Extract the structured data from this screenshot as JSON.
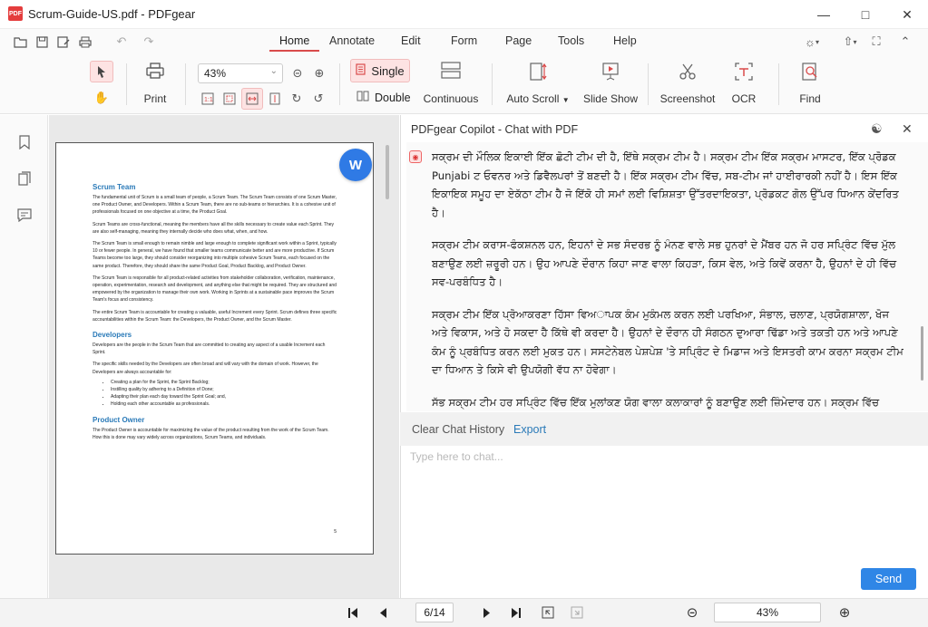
{
  "window": {
    "title": "Scrum-Guide-US.pdf - PDFgear",
    "logo_text": "PDF"
  },
  "menu": {
    "tabs": [
      "Home",
      "Annotate",
      "Edit",
      "Form",
      "Page",
      "Tools",
      "Help"
    ],
    "active_tab": "Home"
  },
  "toolbar": {
    "print_label": "Print",
    "zoom_value": "43%",
    "single_label": "Single",
    "double_label": "Double",
    "continuous_label": "Continuous",
    "auto_scroll_label": "Auto Scroll",
    "slide_show_label": "Slide Show",
    "screenshot_label": "Screenshot",
    "ocr_label": "OCR",
    "find_label": "Find"
  },
  "document": {
    "sections": [
      {
        "heading": "Scrum Team",
        "paragraphs": [
          "The fundamental unit of Scrum is a small team of people, a Scrum Team. The Scrum Team consists of one Scrum Master, one Product Owner, and Developers. Within a Scrum Team, there are no sub-teams or hierarchies. It is a cohesive unit of professionals focused on one objective at a time, the Product Goal.",
          "Scrum Teams are cross-functional, meaning the members have all the skills necessary to create value each Sprint. They are also self-managing, meaning they internally decide who does what, when, and how.",
          "The Scrum Team is small enough to remain nimble and large enough to complete significant work within a Sprint, typically 10 or fewer people. In general, we have found that smaller teams communicate better and are more productive. If Scrum Teams become too large, they should consider reorganizing into multiple cohesive Scrum Teams, each focused on the same product. Therefore, they should share the same Product Goal, Product Backlog, and Product Owner.",
          "The Scrum Team is responsible for all product-related activities from stakeholder collaboration, verification, maintenance, operation, experimentation, research and development, and anything else that might be required. They are structured and empowered by the organization to manage their own work. Working in Sprints at a sustainable pace improves the Scrum Team's focus and consistency.",
          "The entire Scrum Team is accountable for creating a valuable, useful Increment every Sprint. Scrum defines three specific accountabilities within the Scrum Team: the Developers, the Product Owner, and the Scrum Master."
        ]
      },
      {
        "heading": "Developers",
        "paragraphs": [
          "Developers are the people in the Scrum Team that are committed to creating any aspect of a usable Increment each Sprint.",
          "The specific skills needed by the Developers are often broad and will vary with the domain of work. However, the Developers are always accountable for:"
        ],
        "bullets": [
          "Creating a plan for the Sprint, the Sprint Backlog;",
          "Instilling quality by adhering to a Definition of Done;",
          "Adapting their plan each day toward the Sprint Goal; and,",
          "Holding each other accountable as professionals."
        ]
      },
      {
        "heading": "Product Owner",
        "paragraphs": [
          "The Product Owner is accountable for maximizing the value of the product resulting from the work of the Scrum Team. How this is done may vary widely across organizations, Scrum Teams, and individuals."
        ]
      }
    ],
    "page_number": "5"
  },
  "copilot": {
    "title": "PDFgear Copilot - Chat with PDF",
    "messages": [
      "ਸਕ੍ਰਮ ਦੀ ਮੌਲਿਕ ਇਕਾਈ ਇੱਕ ਛੋਟੀ ਟੀਮ ਦੀ ਹੈ, ਇੱਥੇ ਸਕ੍ਰਮ ਟੀਮ ਹੈ। ਸਕ੍ਰਮ ਟੀਮ ਇੱਕ ਸਕ੍ਰਮ ਮਾਸਟਰ, ਇੱਕ ਪ੍ਰੋਡਕ Punjabi ਟ ਓਵਨਰ ਅਤੇ ਡਿਵੈਲਪਰਾਂ ਤੋਂ ਬਣਦੀ ਹੈ। ਇੱਕ ਸਕ੍ਰਮ ਟੀਮ ਵਿੱਚ, ਸਬ-ਟੀਮ ਜਾਂ ਹਾਈਰਾਰਕੀ ਨਹੀਂ ਹੈ। ਇਸ ਇੱਕ ਇਕਾਇਕ ਸਮੂਹ ਦਾ ਏਕੱਠਾ ਟੀਮ ਹੈ ਜੋ ਇੱਕੋ ਹੀ ਸਮਾਂ ਲਈ ਵਿਸ਼ਿਸ਼ਤਾ ਉੱਤਰਦਾਇਕਤਾ, ਪ੍ਰੋਡਕਟ ਗੋਲ ਉੱਪਰ ਧਿਆਨ ਕੇਂਦਰਿਤ ਹੈ।",
      "ਸਕ੍ਰਮ ਟੀਮ ਕਰਾਸ-ਫੰਕਸ਼ਨਲ ਹਨ, ਇਹਨਾਂ ਦੇ ਸਭ ਸੰਦਰਭ ਨੂੰ ਮੰਨਣ ਵਾਲੇ ਸਭ ਹੁਨਰਾਂ ਦੇ ਮੈਂਬਰ ਹਨ ਜੋ ਹਰ ਸਪ੍ਰਿੰਟ ਵਿੱਚ ਮੁੱਲ ਬਣਾਉਣ ਲਈ ਜ਼ਰੂਰੀ ਹਨ। ਉਹ ਆਪਣੇ ਦੌਰਾਨ ਕਿਹਾ ਜਾਣ ਵਾਲਾ ਕਿਹੜਾ, ਕਿਸ ਵੇਲ, ਅਤੇ ਕਿਵੇਂ ਕਰਨਾ ਹੈ, ਉਹਨਾਂ ਦੇ ਹੀ ਵਿੱਚ ਸਵ-ਪਰਬੰਧਿਤ ਹੈ।",
      "ਸਕ੍ਰਮ ਟੀਮ ਇੱਕ ਪ੍ਰੋਆਕਰਣਾ ਹਿੱਸਾ ਵਿਅਾਪਕ ਕੰਮ ਮੁਕੰਮਲ ਕਰਨ ਲਈ ਪਰਖਿਆ, ਸੰਭਾਲ, ਚਲਾਣ, ਪ੍ਰਯੋਗਸ਼ਾਲਾ, ਖੋਜ ਅਤੇ ਵਿਕਾਸ, ਅਤੇ ਹੋ ਸਕਦਾ ਹੈ ਕਿੱਥੇ ਵੀ ਕਰਦਾ ਹੈ। ਉਹਨਾਂ ਦੇ ਦੌਰਾਨ ਹੀ ਸੰਗਠਨ ਦੁਆਰਾ ਢਿੱਡਾ ਅਤੇ ਤਕਤੀ ਹਨ ਅਤੇ ਆਪਣੇ ਕੰਮ ਨੂੰ ਪ੍ਰਬੰਧਿਤ ਕਰਨ ਲਈ ਮੁਕਤ ਹਨ। ਸਸਟੇਨੇਬਲ ਪੇਸ਼ਪੇਸ਼ 'ਤੇ ਸਪ੍ਰਿੰਟ ਦੇ ਮਿਡਾਜ ਅਤੇ ਇਸਤਰੀ ਕਾਮ ਕਰਨਾ ਸਕ੍ਰਮ ਟੀਮ ਦਾ ਧਿਆਨ ਤੇ ਕਿਸੇ ਵੀ ਉਪਯੋਗੀ ਵੱਧ ਨਾ ਹੋਵੇਗਾ।",
      "ਸੱਭ ਸਕ੍ਰਮ ਟੀਮ ਹਰ ਸਪ੍ਰਿੰਟ ਵਿੱਚ ਇੱਕ ਮੁਲਾਂਕਣ ਯੋਗ ਵਾਲਾ ਕਲਾਕਾਰਾਂ ਨੂੰ ਬਣਾਉਣ ਲਈ ਜ਼ਿੰਮੇਦਾਰ ਹਨ। ਸਕ੍ਰਮ ਵਿੱਚ ਸਕ੍ਰਮ ਟੀਮ ਵਿਚ ਤਿੰਨ ਵਿਸ਼ੇਸ਼ ਜ਼ਿੰਮੇਦਾਰੀ ਹਨ: ਡਿਵੈਲਪਰਾਂ, ਪ੍ਰੋਡਕਟ ਓਵਨਰ ਅਤੇ ਸਕ੍ਰਮ ਮਾਸਟਰ।"
    ],
    "clear_label": "Clear Chat History",
    "export_label": "Export",
    "input_placeholder": "Type here to chat...",
    "send_label": "Send"
  },
  "statusbar": {
    "page_indicator": "6/14",
    "zoom": "43%"
  },
  "colors": {
    "accent": "#d94b4b",
    "highlight_bg": "#fde3e3",
    "link": "#2a7ab8",
    "send_button": "#2f86e6"
  }
}
